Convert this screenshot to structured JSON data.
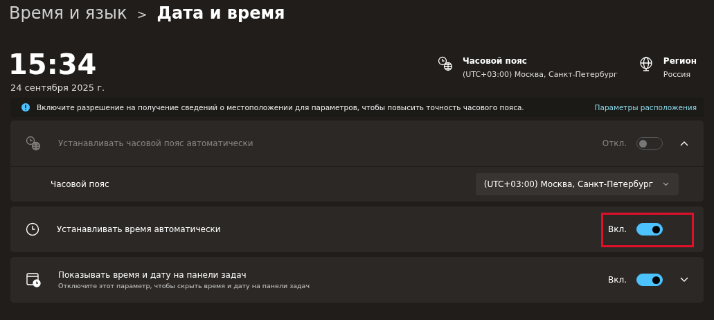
{
  "breadcrumb": {
    "parent": "Время и язык",
    "separator": ">",
    "current": "Дата и время"
  },
  "clock": {
    "time": "15:34",
    "date": "24 сентября 2025 г."
  },
  "summary": [
    {
      "kind": "timezone",
      "title": "Часовой пояс",
      "value": "(UTC+03:00) Москва, Санкт-Петербург"
    },
    {
      "kind": "region",
      "title": "Регион",
      "value": "Россия"
    }
  ],
  "info_bar": {
    "text": "Включите разрешение на получение сведений о местоположении для параметров, чтобы повысить точность часового пояса.",
    "link": "Параметры расположения"
  },
  "cards": [
    {
      "title": "Устанавливать часовой пояс автоматически",
      "state_label": "Откл.",
      "on": false,
      "disabled": true,
      "expanded": true,
      "sub_rows": [
        {
          "label": "Часовой пояс",
          "value": "(UTC+03:00) Москва, Санкт-Петербург"
        }
      ]
    },
    {
      "title": "Устанавливать время автоматически",
      "state_label": "Вкл.",
      "on": true,
      "disabled": false,
      "highlighted": true
    },
    {
      "title": "Показывать время и дату на панели задач",
      "description": "Отключите этот параметр, чтобы скрыть время и дату на панели задач",
      "state_label": "Вкл.",
      "on": true,
      "disabled": false,
      "expanded": false
    }
  ]
}
